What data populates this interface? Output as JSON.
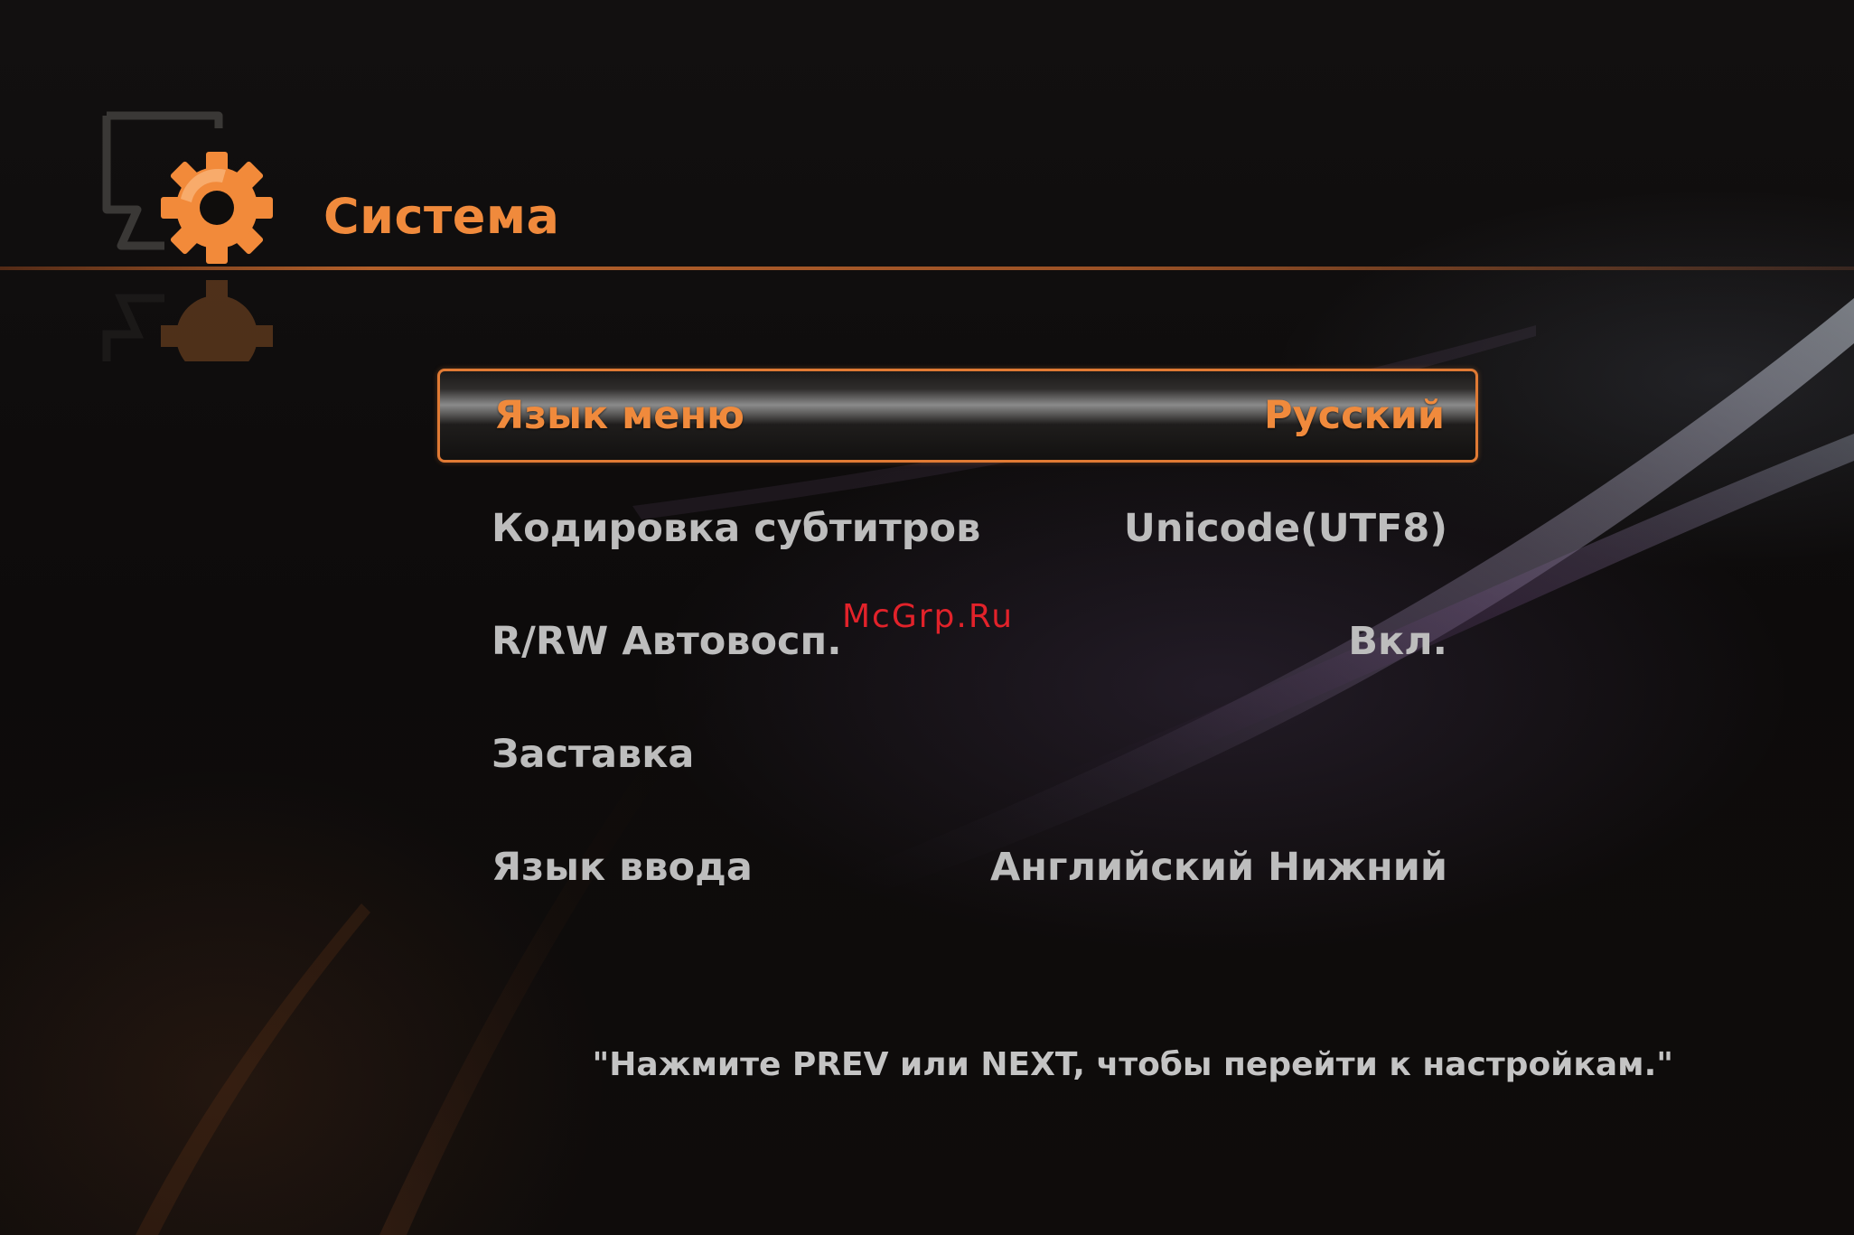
{
  "header": {
    "title": "Система",
    "icon": "system-settings-gear-icon",
    "accent_color": "#f08a3c"
  },
  "menu": {
    "items": [
      {
        "label": "Язык меню",
        "value": "Русский",
        "selected": true
      },
      {
        "label": "Кодировка субтитров",
        "value": "Unicode(UTF8)",
        "selected": false
      },
      {
        "label": "R/RW Автовосп.",
        "value": "Вкл.",
        "selected": false
      },
      {
        "label": "Заставка",
        "value": "",
        "selected": false
      },
      {
        "label": "Язык ввода",
        "value": "Английский Нижний",
        "selected": false
      }
    ]
  },
  "hint": "\"Нажмите PREV или NEXT, чтобы перейти к настройкам.\"",
  "watermark": "McGrp.Ru"
}
